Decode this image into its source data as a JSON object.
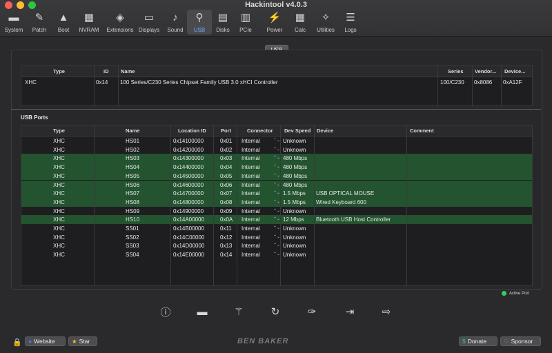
{
  "window": {
    "title": "Hackintool v4.0.3"
  },
  "toolbar": [
    {
      "label": "System",
      "icon": "system-icon",
      "glyph": "▬"
    },
    {
      "label": "Patch",
      "icon": "patch-icon",
      "glyph": "✎"
    },
    {
      "label": "Boot",
      "icon": "boot-icon",
      "glyph": "▲"
    },
    {
      "label": "NVRAM",
      "icon": "nvram-icon",
      "glyph": "▦"
    },
    {
      "label": "Extensions",
      "icon": "extensions-icon",
      "glyph": "◈"
    },
    {
      "label": "Displays",
      "icon": "displays-icon",
      "glyph": "▭"
    },
    {
      "label": "Sound",
      "icon": "sound-icon",
      "glyph": "♪"
    },
    {
      "label": "USB",
      "icon": "usb-icon",
      "glyph": "⚲"
    },
    {
      "label": "Disks",
      "icon": "disks-icon",
      "glyph": "▤"
    },
    {
      "label": "PCIe",
      "icon": "pcie-icon",
      "glyph": "▥"
    },
    {
      "label": "Power",
      "icon": "power-icon",
      "glyph": "⚡"
    },
    {
      "label": "Calc",
      "icon": "calc-icon",
      "glyph": "▦"
    },
    {
      "label": "Utilities",
      "icon": "utilities-icon",
      "glyph": "✧"
    },
    {
      "label": "Logs",
      "icon": "logs-icon",
      "glyph": "☰"
    }
  ],
  "section_tab": "USB",
  "controllers": {
    "headers": [
      "Type",
      "ID",
      "Name",
      "Series",
      "Vendor...",
      "Device..."
    ],
    "rows": [
      {
        "type": "XHC",
        "id": "0x14",
        "name": "100 Series/C230 Series Chipset Family USB 3.0 xHCI Controller",
        "series": "100/C230",
        "vendor": "0x8086",
        "device": "0xA12F"
      }
    ]
  },
  "ports": {
    "title": "USB Ports",
    "headers": [
      "Type",
      "Name",
      "Location ID",
      "Port",
      "Connector",
      "Dev Speed",
      "Device",
      "Comment"
    ],
    "rows": [
      {
        "type": "XHC",
        "name": "HS01",
        "location": "0x14100000",
        "port": "0x01",
        "connector": "Internal",
        "speed": "Unknown",
        "device": "",
        "comment": "",
        "active": false
      },
      {
        "type": "XHC",
        "name": "HS02",
        "location": "0x14200000",
        "port": "0x02",
        "connector": "Internal",
        "speed": "Unknown",
        "device": "",
        "comment": "",
        "active": false
      },
      {
        "type": "XHC",
        "name": "HS03",
        "location": "0x14300000",
        "port": "0x03",
        "connector": "Internal",
        "speed": "480 Mbps",
        "device": "",
        "comment": "",
        "active": true
      },
      {
        "type": "XHC",
        "name": "HS04",
        "location": "0x14400000",
        "port": "0x04",
        "connector": "Internal",
        "speed": "480 Mbps",
        "device": "",
        "comment": "",
        "active": true
      },
      {
        "type": "XHC",
        "name": "HS05",
        "location": "0x14500000",
        "port": "0x05",
        "connector": "Internal",
        "speed": "480 Mbps",
        "device": "",
        "comment": "",
        "active": true
      },
      {
        "type": "XHC",
        "name": "HS06",
        "location": "0x14600000",
        "port": "0x06",
        "connector": "Internal",
        "speed": "480 Mbps",
        "device": "",
        "comment": "",
        "active": true
      },
      {
        "type": "XHC",
        "name": "HS07",
        "location": "0x14700000",
        "port": "0x07",
        "connector": "Internal",
        "speed": "1.5 Mbps",
        "device": "USB OPTICAL MOUSE",
        "comment": "",
        "active": true
      },
      {
        "type": "XHC",
        "name": "HS08",
        "location": "0x14800000",
        "port": "0x08",
        "connector": "Internal",
        "speed": "1.5 Mbps",
        "device": "Wired Keyboard 600",
        "comment": "",
        "active": true
      },
      {
        "type": "XHC",
        "name": "HS09",
        "location": "0x14900000",
        "port": "0x09",
        "connector": "Internal",
        "speed": "Unknown",
        "device": "",
        "comment": "",
        "active": false
      },
      {
        "type": "XHC",
        "name": "HS10",
        "location": "0x14A00000",
        "port": "0x0A",
        "connector": "Internal",
        "speed": "12 Mbps",
        "device": "Bluetooth USB Host Controller",
        "comment": "",
        "active": true
      },
      {
        "type": "XHC",
        "name": "SS01",
        "location": "0x14B00000",
        "port": "0x11",
        "connector": "Internal",
        "speed": "Unknown",
        "device": "",
        "comment": "",
        "active": false
      },
      {
        "type": "XHC",
        "name": "SS02",
        "location": "0x14C00000",
        "port": "0x12",
        "connector": "Internal",
        "speed": "Unknown",
        "device": "",
        "comment": "",
        "active": false
      },
      {
        "type": "XHC",
        "name": "SS03",
        "location": "0x14D00000",
        "port": "0x13",
        "connector": "Internal",
        "speed": "Unknown",
        "device": "",
        "comment": "",
        "active": false
      },
      {
        "type": "XHC",
        "name": "SS04",
        "location": "0x14E00000",
        "port": "0x14",
        "connector": "Internal",
        "speed": "Unknown",
        "device": "",
        "comment": "",
        "active": false
      }
    ]
  },
  "legend": {
    "active_port": "Active Port",
    "color": "#2fd160"
  },
  "actions": [
    {
      "name": "info-icon",
      "glyph": "ⓘ"
    },
    {
      "name": "remove-icon",
      "glyph": "▬"
    },
    {
      "name": "clear-broom-icon",
      "glyph": "⚚"
    },
    {
      "name": "refresh-icon",
      "glyph": "↻"
    },
    {
      "name": "inject-syringe-icon",
      "glyph": "✑"
    },
    {
      "name": "import-icon",
      "glyph": "⇥"
    },
    {
      "name": "export-icon",
      "glyph": "⇨"
    }
  ],
  "footer": {
    "website": "Website",
    "star": "Star",
    "logo": "BEN BAKER",
    "donate": "Donate",
    "sponsor": "Sponsor"
  },
  "colors": {
    "active_row": "#23532f",
    "accent": "#6ab0ff"
  }
}
